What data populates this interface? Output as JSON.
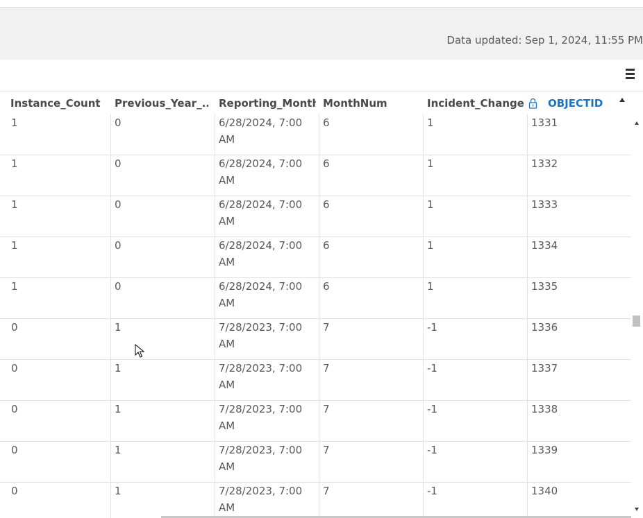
{
  "header": {
    "updated_text": "Data updated: Sep 1, 2024, 11:55 PM"
  },
  "toolbar": {
    "menu_icon": "hamburger-menu-icon"
  },
  "table": {
    "columns": [
      {
        "label": "Instance_Count"
      },
      {
        "label": "Previous_Year_..."
      },
      {
        "label": "Reporting_Month"
      },
      {
        "label": "MonthNum"
      },
      {
        "label": "Incident_Change"
      },
      {
        "label": "OBJECTID",
        "locked": true,
        "sorted": "ascending"
      }
    ],
    "rows": [
      {
        "instance_count": "1",
        "previous_year": "0",
        "reporting_month_line1": "6/28/2024, 7:00",
        "reporting_month_line2": "AM",
        "month_num": "6",
        "incident_change": "1",
        "objectid": "1331"
      },
      {
        "instance_count": "1",
        "previous_year": "0",
        "reporting_month_line1": "6/28/2024, 7:00",
        "reporting_month_line2": "AM",
        "month_num": "6",
        "incident_change": "1",
        "objectid": "1332"
      },
      {
        "instance_count": "1",
        "previous_year": "0",
        "reporting_month_line1": "6/28/2024, 7:00",
        "reporting_month_line2": "AM",
        "month_num": "6",
        "incident_change": "1",
        "objectid": "1333"
      },
      {
        "instance_count": "1",
        "previous_year": "0",
        "reporting_month_line1": "6/28/2024, 7:00",
        "reporting_month_line2": "AM",
        "month_num": "6",
        "incident_change": "1",
        "objectid": "1334"
      },
      {
        "instance_count": "1",
        "previous_year": "0",
        "reporting_month_line1": "6/28/2024, 7:00",
        "reporting_month_line2": "AM",
        "month_num": "6",
        "incident_change": "1",
        "objectid": "1335"
      },
      {
        "instance_count": "0",
        "previous_year": "1",
        "reporting_month_line1": "7/28/2023, 7:00",
        "reporting_month_line2": "AM",
        "month_num": "7",
        "incident_change": "-1",
        "objectid": "1336"
      },
      {
        "instance_count": "0",
        "previous_year": "1",
        "reporting_month_line1": "7/28/2023, 7:00",
        "reporting_month_line2": "AM",
        "month_num": "7",
        "incident_change": "-1",
        "objectid": "1337"
      },
      {
        "instance_count": "0",
        "previous_year": "1",
        "reporting_month_line1": "7/28/2023, 7:00",
        "reporting_month_line2": "AM",
        "month_num": "7",
        "incident_change": "-1",
        "objectid": "1338"
      },
      {
        "instance_count": "0",
        "previous_year": "1",
        "reporting_month_line1": "7/28/2023, 7:00",
        "reporting_month_line2": "AM",
        "month_num": "7",
        "incident_change": "-1",
        "objectid": "1339"
      },
      {
        "instance_count": "0",
        "previous_year": "1",
        "reporting_month_line1": "7/28/2023, 7:00",
        "reporting_month_line2": "AM",
        "month_num": "7",
        "incident_change": "-1",
        "objectid": "1340"
      }
    ]
  },
  "colors": {
    "header_band": "#f1f1f2",
    "sorted_header": "#1e73be",
    "grid_line": "#e2e2e2",
    "text": "#595959"
  }
}
